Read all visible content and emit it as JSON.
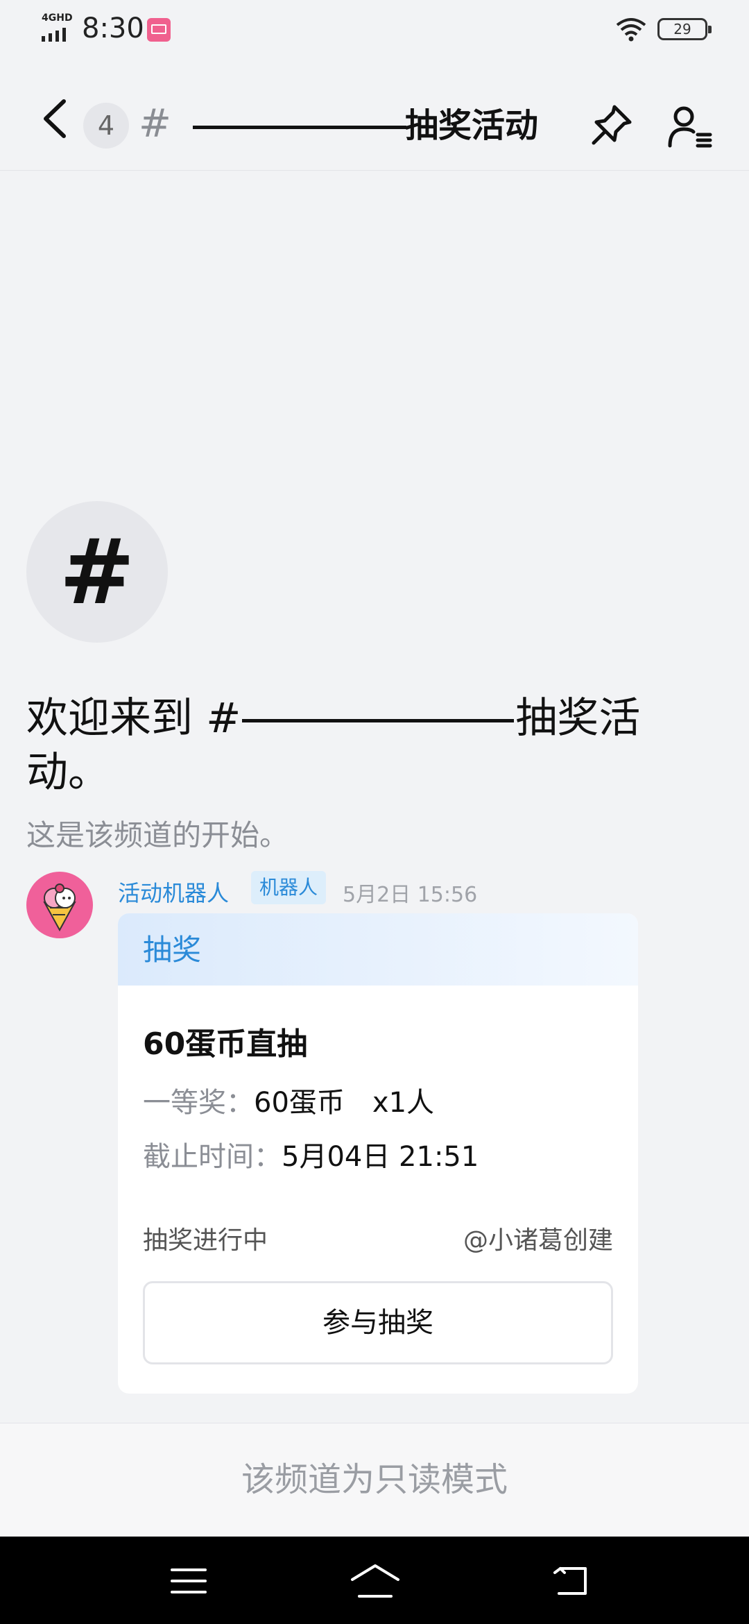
{
  "status_bar": {
    "network": "4GHD",
    "time": "8:30",
    "battery": "29"
  },
  "header": {
    "unread_count": "4",
    "channel_hash": "#",
    "title": "抽奖活动"
  },
  "welcome": {
    "avatar_glyph": "#",
    "title_prefix": "欢迎来到 #",
    "title_suffix": "抽奖活动。",
    "subtitle": "这是该频道的开始。"
  },
  "message": {
    "author": "活动机器人",
    "tag": "机器人",
    "time": "5月2日 15:56",
    "card": {
      "header": "抽奖",
      "title": "60蛋币直抽",
      "prize_label": "一等奖：",
      "prize_value": "60蛋币　x1人",
      "deadline_label": "截止时间：",
      "deadline_value": "5月04日 21:51",
      "status": "抽奖进行中",
      "creator": "@小诸葛创建",
      "button": "参与抽奖"
    }
  },
  "readonly_notice": "该频道为只读模式",
  "colors": {
    "accent": "#2a8ad8",
    "background": "#f2f3f5",
    "avatar_pink": "#f0609a"
  }
}
